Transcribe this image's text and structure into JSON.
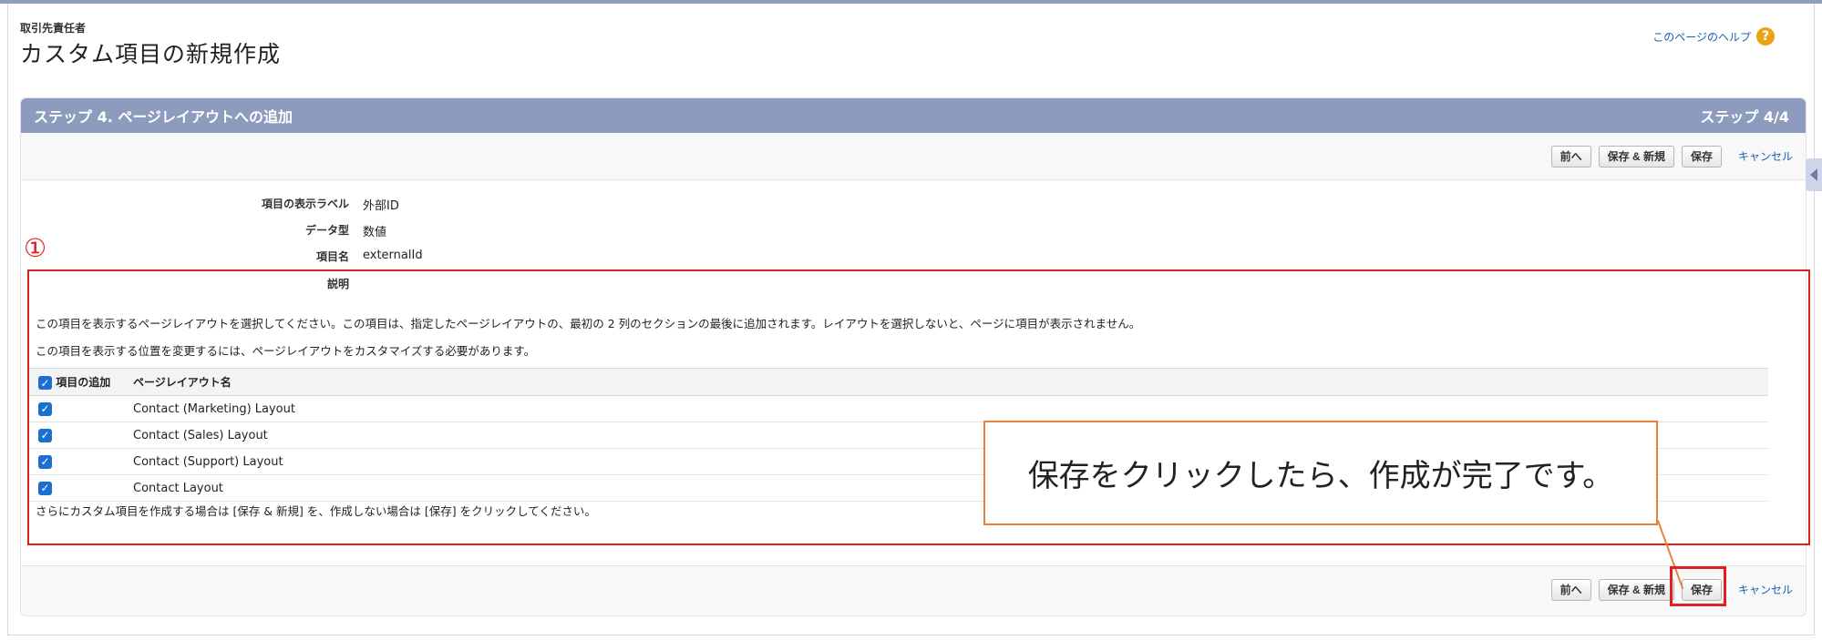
{
  "header": {
    "object_label": "取引先責任者",
    "title": "カスタム項目の新規作成",
    "help_link": "このページのヘルプ",
    "help_icon": "question-icon"
  },
  "step": {
    "title": "ステップ 4. ページレイアウトへの追加",
    "counter": "ステップ 4/4"
  },
  "toolbar": {
    "prev_label": "前へ",
    "save_new_label": "保存 & 新規",
    "save_label": "保存",
    "cancel_label": "キャンセル"
  },
  "details": [
    {
      "label": "項目の表示ラベル",
      "value": "外部ID"
    },
    {
      "label": "データ型",
      "value": "数値"
    },
    {
      "label": "項目名",
      "value": "externalId"
    },
    {
      "label": "説明",
      "value": ""
    }
  ],
  "instructions": {
    "line1": "この項目を表示するページレイアウトを選択してください。この項目は、指定したページレイアウトの、最初の 2 列のセクションの最後に追加されます。レイアウトを選択しないと、ページに項目が表示されません。",
    "line2": "この項目を表示する位置を変更するには、ページレイアウトをカスタマイズする必要があります。",
    "footer": "さらにカスタム項目を作成する場合は [保存 & 新規] を、作成しない場合は [保存] をクリックしてください。"
  },
  "layout_table": {
    "headers": [
      "項目の追加",
      "ページレイアウト名"
    ],
    "rows": [
      {
        "checked": true,
        "name": "Contact (Marketing) Layout"
      },
      {
        "checked": true,
        "name": "Contact (Sales) Layout"
      },
      {
        "checked": true,
        "name": "Contact (Support) Layout"
      },
      {
        "checked": true,
        "name": "Contact Layout"
      }
    ]
  },
  "annotations": {
    "circle_number": "①",
    "callout_text": "保存をクリックしたら、作成が完了です。",
    "red_color": "#e02020",
    "orange_color": "#e8823a"
  },
  "colors": {
    "header_bar": "#8d9bbf",
    "checkbox": "#1c6fd1",
    "link": "#1a5fb4"
  }
}
